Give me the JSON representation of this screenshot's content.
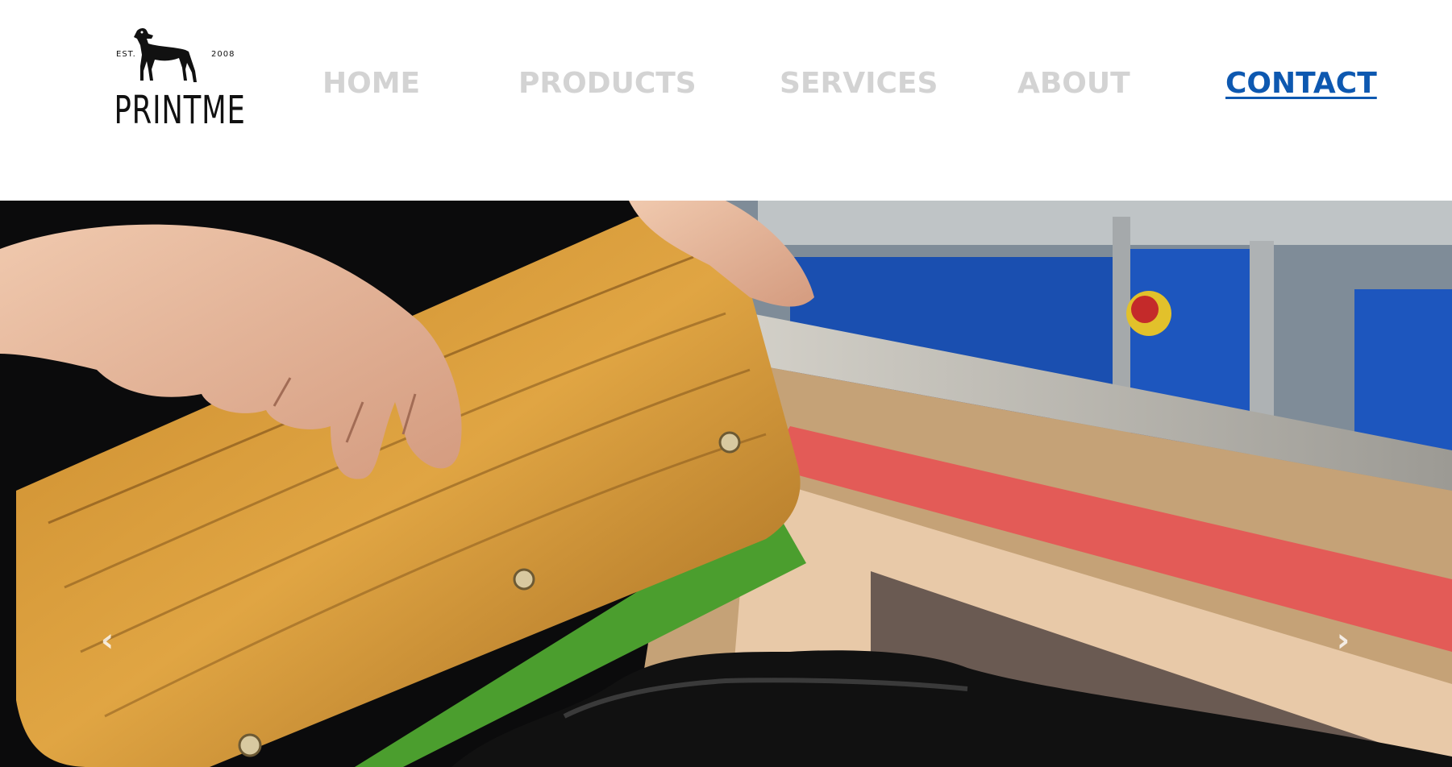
{
  "logo": {
    "est": "EST.",
    "year": "2008",
    "wordmark": "PRINTME",
    "icon": "dog-silhouette-icon"
  },
  "nav": {
    "items": [
      {
        "label": "HOME",
        "active": false
      },
      {
        "label": "PRODUCTS",
        "active": false
      },
      {
        "label": "SERVICES",
        "active": false
      },
      {
        "label": "ABOUT",
        "active": false
      },
      {
        "label": "CONTACT",
        "active": true
      }
    ]
  },
  "hero": {
    "image": "screen-printing-squeegee-photo",
    "prev_icon": "chevron-left-icon",
    "next_icon": "chevron-right-icon",
    "prev_glyph": "‹",
    "next_glyph": "›"
  },
  "colors": {
    "nav_inactive": "#d3d3d3",
    "nav_active": "#0d58b0",
    "background": "#ffffff"
  }
}
